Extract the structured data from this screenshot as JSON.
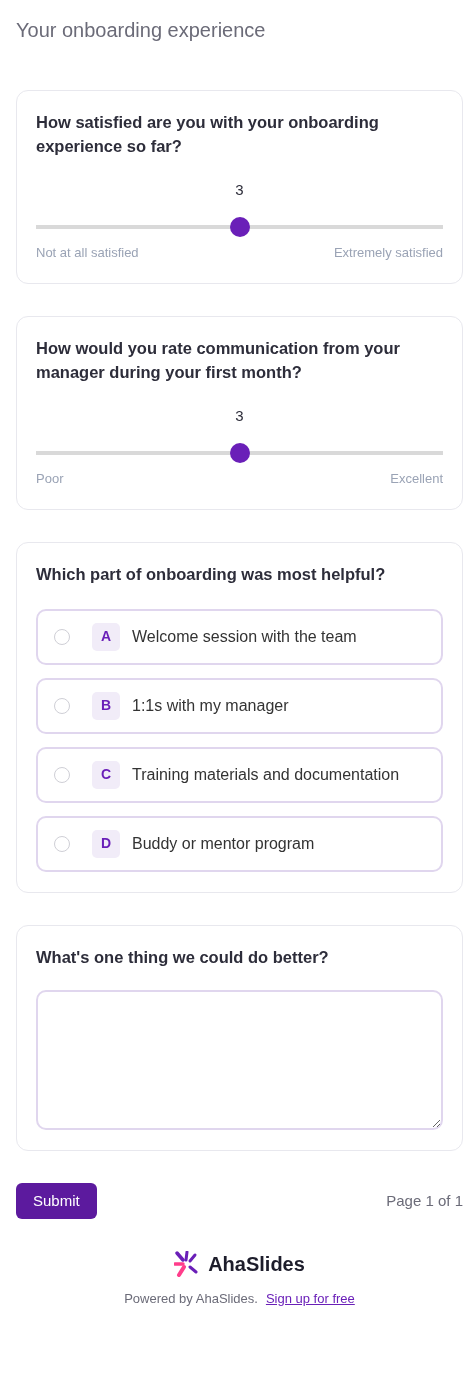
{
  "title": "Your onboarding experience",
  "questions": [
    {
      "kind": "slider",
      "question": "How satisfied are you with your onboarding experience so far?",
      "value": "3",
      "level": 0.5,
      "min_label": "Not at all satisfied",
      "max_label": "Extremely satisfied"
    },
    {
      "kind": "slider",
      "question": "How would you rate communication from your manager during your first month?",
      "value": "3",
      "level": 0.5,
      "min_label": "Poor",
      "max_label": "Excellent"
    },
    {
      "kind": "choice",
      "question": "Which part of onboarding was most helpful?",
      "options": [
        {
          "letter": "A",
          "label": "Welcome session with the team",
          "selected": false
        },
        {
          "letter": "B",
          "label": "1:1s with my manager",
          "selected": false
        },
        {
          "letter": "C",
          "label": "Training materials and documentation",
          "selected": false
        },
        {
          "letter": "D",
          "label": "Buddy or mentor program",
          "selected": false
        }
      ]
    },
    {
      "kind": "text",
      "question": "What's one thing we could do better?"
    }
  ],
  "submit": "Submit",
  "page": "Page 1 of 1",
  "brand": "AhaSlides",
  "powered_by": "Powered by AhaSlides.",
  "signup_link": "Sign up for free"
}
